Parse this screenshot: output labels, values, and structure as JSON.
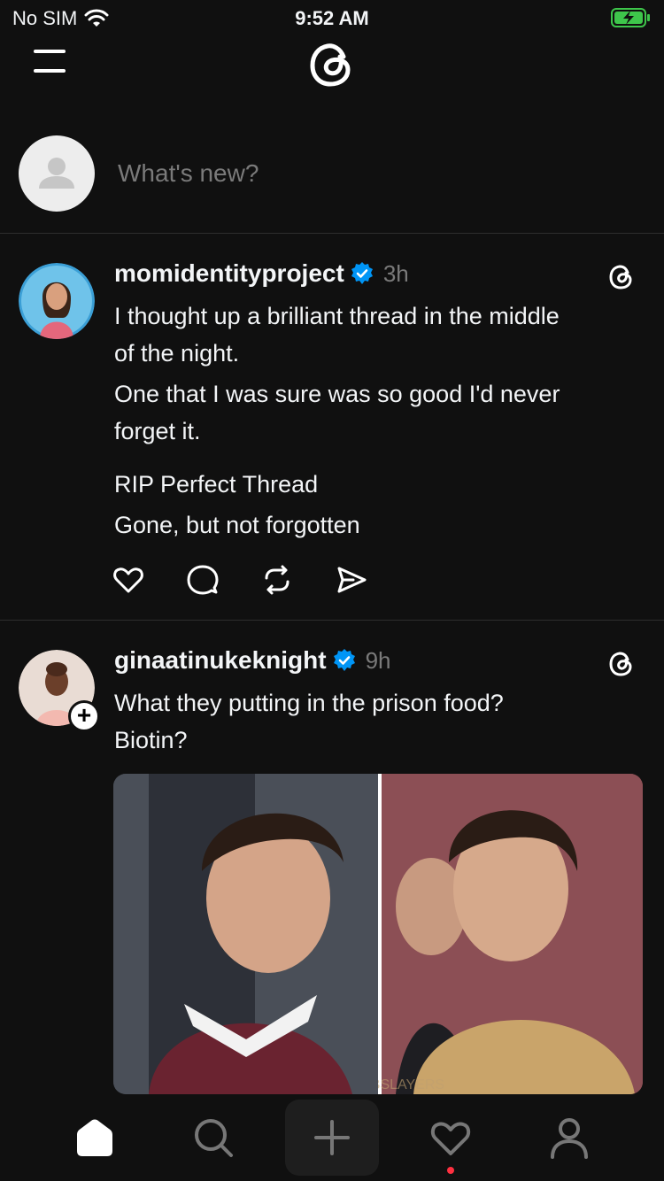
{
  "status": {
    "carrier": "No SIM",
    "time": "9:52 AM"
  },
  "composer": {
    "placeholder": "What's new?"
  },
  "posts": [
    {
      "username": "momidentityproject",
      "time": "3h",
      "lines": [
        "I thought up a brilliant thread in the middle",
        "of the night.",
        "One that I was sure was so good I'd never",
        "forget it.",
        "RIP Perfect Thread",
        "Gone, but not forgotten"
      ]
    },
    {
      "username": "ginaatinukeknight",
      "time": "9h",
      "lines": [
        "What they putting in the prison food?",
        "Biotin?"
      ],
      "watermark": "CELEBSLAYERS"
    }
  ],
  "icons": {
    "menu": "menu-icon",
    "logo": "threads-logo-icon",
    "like": "heart-icon",
    "reply": "comment-icon",
    "repost": "repost-icon",
    "share": "send-icon",
    "tabs": [
      "home-icon",
      "search-icon",
      "plus-icon",
      "heart-icon",
      "profile-icon"
    ]
  },
  "colors": {
    "background": "#101010",
    "text": "#f3f5f7",
    "muted": "#7a7a7a",
    "verified": "#0095f6",
    "notification": "#ff3040"
  }
}
